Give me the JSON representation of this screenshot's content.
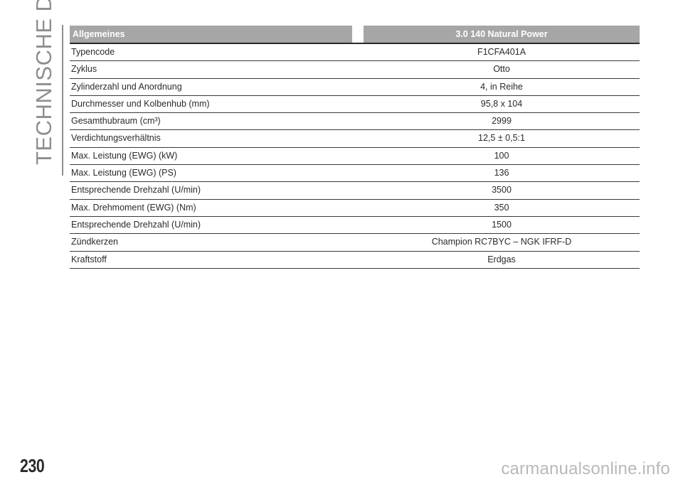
{
  "side_title": "TECHNISCHE DATEN",
  "table": {
    "header_left": "Allgemeines",
    "header_right": "3.0 140 Natural Power",
    "rows": [
      {
        "label": "Typencode",
        "value": "F1CFA401A"
      },
      {
        "label": "Zyklus",
        "value": "Otto"
      },
      {
        "label": "Zylinderzahl und Anordnung",
        "value": "4, in Reihe"
      },
      {
        "label": "Durchmesser und Kolbenhub (mm)",
        "value": "95,8 x 104"
      },
      {
        "label": "Gesamthubraum (cm³)",
        "value": "2999"
      },
      {
        "label": "Verdichtungsverhältnis",
        "value": "12,5 ± 0,5:1"
      },
      {
        "label": "Max. Leistung (EWG) (kW)",
        "value": "100"
      },
      {
        "label": "Max. Leistung (EWG) (PS)",
        "value": "136"
      },
      {
        "label": "Entsprechende Drehzahl (U/min)",
        "value": "3500"
      },
      {
        "label": "Max. Drehmoment (EWG) (Nm)",
        "value": "350"
      },
      {
        "label": "Entsprechende Drehzahl (U/min)",
        "value": "1500"
      },
      {
        "label": "Zündkerzen",
        "value": "Champion RC7BYC – NGK IFRF-D"
      },
      {
        "label": "Kraftstoff",
        "value": "Erdgas"
      }
    ]
  },
  "page_number": "230",
  "watermark": "carmanualsonline.info"
}
